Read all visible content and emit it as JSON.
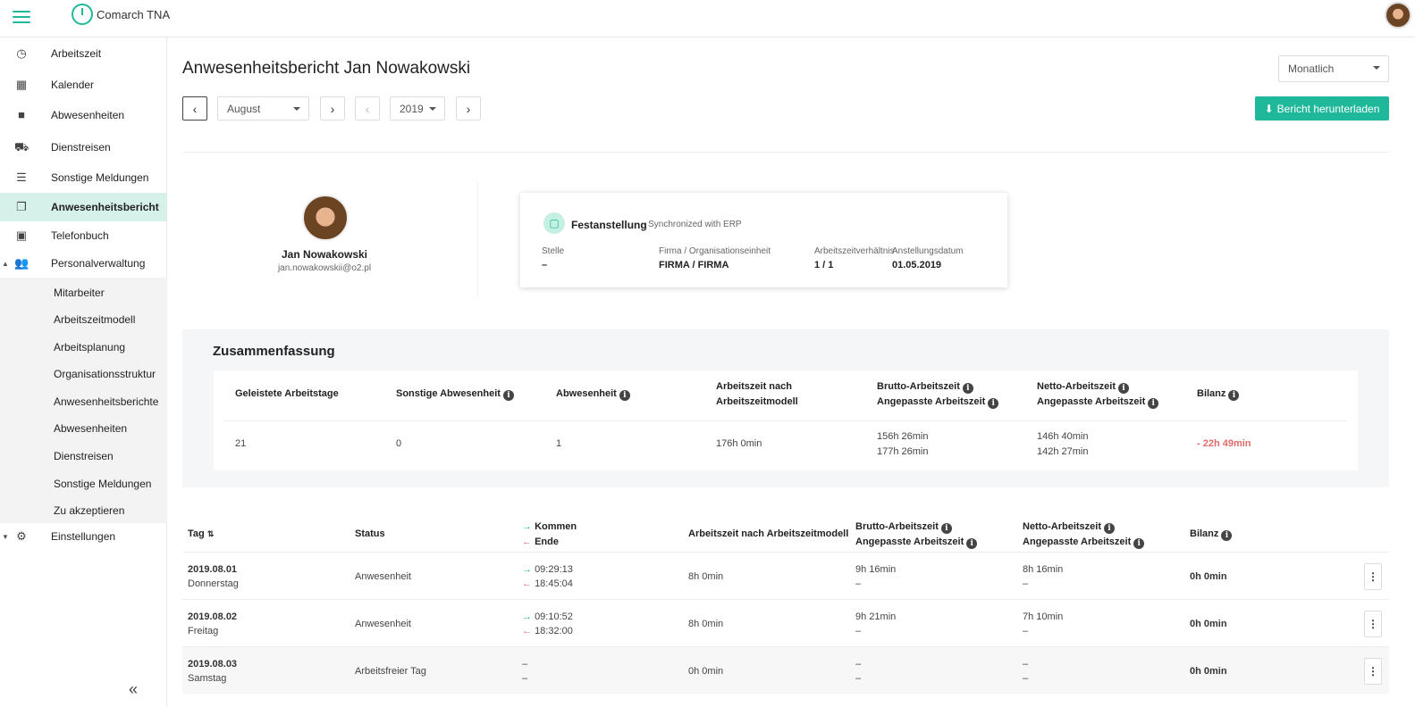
{
  "app": {
    "name": "Comarch TNA"
  },
  "sidebar": {
    "items": [
      {
        "label": "Arbeitszeit",
        "icon": "clock-icon"
      },
      {
        "label": "Kalender",
        "icon": "calendar-icon"
      },
      {
        "label": "Abwesenheiten",
        "icon": "briefcase-icon"
      },
      {
        "label": "Dienstreisen",
        "icon": "car-icon"
      },
      {
        "label": "Sonstige Meldungen",
        "icon": "list-icon"
      },
      {
        "label": "Anwesenheitsbericht",
        "icon": "report-icon"
      },
      {
        "label": "Telefonbuch",
        "icon": "contact-book-icon"
      },
      {
        "label": "Personalverwaltung",
        "icon": "users-icon"
      },
      {
        "label": "Einstellungen",
        "icon": "gear-icon"
      }
    ],
    "subitems": [
      "Mitarbeiter",
      "Arbeitszeitmodell",
      "Arbeitsplanung",
      "Organisationsstruktur",
      "Anwesenheitsberichte",
      "Abwesenheiten",
      "Dienstreisen",
      "Sonstige Meldungen",
      "Zu akzeptieren"
    ],
    "collapse_label": "«"
  },
  "header": {
    "title": "Anwesenheitsbericht Jan Nowakowski",
    "period_select": "Monatlich",
    "month": "August",
    "year": "2019",
    "download_label": "Bericht herunterladen"
  },
  "profile": {
    "name": "Jan Nowakowski",
    "email": "jan.nowakowskii@o2.pl"
  },
  "employment": {
    "type": "Festanstellung",
    "sync": "· Synchronized with ERP",
    "fields": [
      {
        "label": "Stelle",
        "value": "–"
      },
      {
        "label": "Firma / Organisationseinheit",
        "value": "FIRMA / FIRMA"
      },
      {
        "label": "Arbeitszeitverhältnis",
        "value": "1 / 1"
      },
      {
        "label": "Anstellungsdatum",
        "value": "01.05.2019"
      }
    ]
  },
  "summary": {
    "title": "Zusammenfassung",
    "headers": {
      "days": "Geleistete Arbeitstage",
      "other_absence": "Sonstige Abwesenheit",
      "absence": "Abwesenheit",
      "model_time_1": "Arbeitszeit nach",
      "model_time_2": "Arbeitszeitmodell",
      "gross_1": "Brutto-Arbeitszeit",
      "gross_2": "Angepasste Arbeitszeit",
      "net_1": "Netto-Arbeitszeit",
      "net_2": "Angepasste Arbeitszeit",
      "balance": "Bilanz"
    },
    "values": {
      "days": "21",
      "other_absence": "0",
      "absence": "1",
      "model_time": "176h 0min",
      "gross_1": "156h 26min",
      "gross_2": "177h 26min",
      "net_1": "146h 40min",
      "net_2": "142h 27min",
      "balance": "- 22h 49min"
    }
  },
  "table": {
    "headers": {
      "day": "Tag",
      "sort": "⇅",
      "status": "Status",
      "in": "Kommen",
      "out": "Ende",
      "model": "Arbeitszeit nach Arbeitszeitmodell",
      "gross_1": "Brutto-Arbeitszeit",
      "gross_2": "Angepasste Arbeitszeit",
      "net_1": "Netto-Arbeitszeit",
      "net_2": "Angepasste Arbeitszeit",
      "balance": "Bilanz"
    },
    "rows": [
      {
        "date": "2019.08.01",
        "weekday": "Donnerstag",
        "status": "Anwesenheit",
        "in": "09:29:13",
        "out": "18:45:04",
        "model": "8h 0min",
        "gross": "9h 16min",
        "gross_adj": "–",
        "net": "8h 16min",
        "net_adj": "–",
        "balance": "0h 0min"
      },
      {
        "date": "2019.08.02",
        "weekday": "Freitag",
        "status": "Anwesenheit",
        "in": "09:10:52",
        "out": "18:32:00",
        "model": "8h 0min",
        "gross": "9h 21min",
        "gross_adj": "–",
        "net": "7h 10min",
        "net_adj": "–",
        "balance": "0h 0min"
      },
      {
        "date": "2019.08.03",
        "weekday": "Samstag",
        "status": "Arbeitsfreier Tag",
        "in": "–",
        "out": "–",
        "model": "0h 0min",
        "gross": "–",
        "gross_adj": "–",
        "net": "–",
        "net_adj": "–",
        "balance": "0h 0min"
      }
    ]
  },
  "colors": {
    "accent": "#1fb89a",
    "negative": "#e06b6b",
    "active_bg": "#d6f1ea"
  }
}
